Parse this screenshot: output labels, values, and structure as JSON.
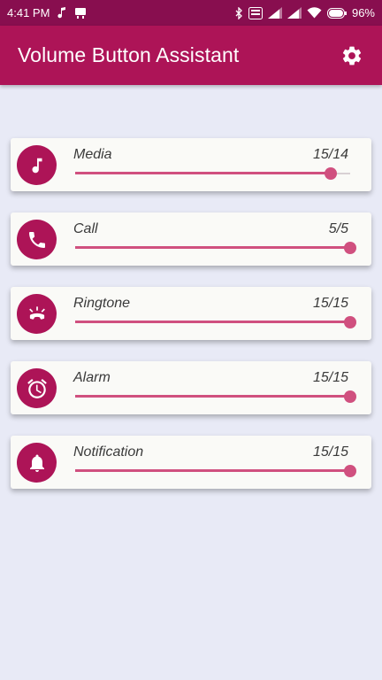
{
  "status_bar": {
    "time": "4:41 PM",
    "battery": "96%",
    "icons": [
      "music-note-icon",
      "notification-icon",
      "bluetooth-icon",
      "volte-icon",
      "signal-icon",
      "signal-icon",
      "wifi-icon",
      "battery-icon"
    ]
  },
  "app_bar": {
    "title": "Volume Button Assistant",
    "settings_icon": "gear-icon"
  },
  "colors": {
    "primary": "#ad1457",
    "primary_dark": "#880e4f",
    "accent": "#d0507f",
    "background": "#e8eaf6"
  },
  "streams": [
    {
      "label": "Media",
      "value_text": "15/14",
      "level": 0.93,
      "icon": "music-note-icon"
    },
    {
      "label": "Call",
      "value_text": "5/5",
      "level": 1.0,
      "icon": "phone-icon"
    },
    {
      "label": "Ringtone",
      "value_text": "15/15",
      "level": 1.0,
      "icon": "ringing-phone-icon"
    },
    {
      "label": "Alarm",
      "value_text": "15/15",
      "level": 1.0,
      "icon": "alarm-clock-icon"
    },
    {
      "label": "Notification",
      "value_text": "15/15",
      "level": 1.0,
      "icon": "bell-icon"
    }
  ]
}
